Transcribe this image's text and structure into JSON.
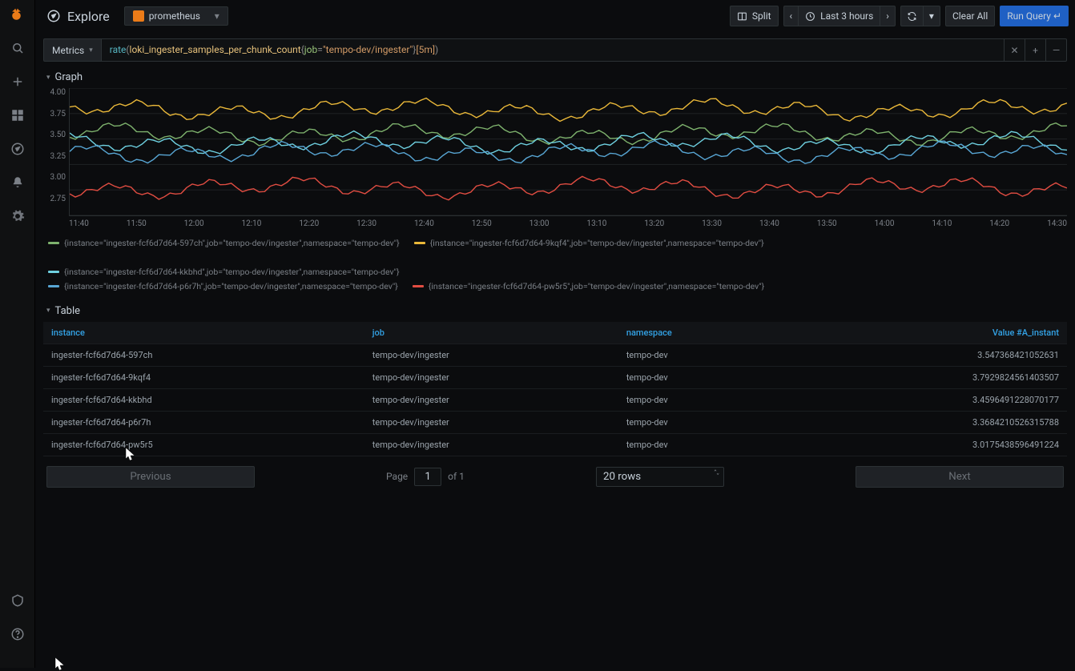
{
  "header": {
    "title": "Explore",
    "datasource": "prometheus",
    "split": "Split",
    "time_range": "Last 3 hours",
    "clear": "Clear All",
    "run": "Run Query ↵"
  },
  "query": {
    "metrics_btn": "Metrics",
    "expr_func": "rate",
    "expr_open": "(",
    "expr_metric": "loki_ingester_samples_per_chunk_count",
    "expr_brace_open": "{",
    "expr_label": "job",
    "expr_eq": "=",
    "expr_value": "\"tempo-dev/ingester\"",
    "expr_brace_close": "}",
    "expr_range": "[5m]",
    "expr_close": ")"
  },
  "sections": {
    "graph": "Graph",
    "table": "Table"
  },
  "chart_data": {
    "type": "line",
    "xlabel": "",
    "ylabel": "",
    "ylim": [
      2.75,
      4.0
    ],
    "yticks": [
      "4.00",
      "3.75",
      "3.50",
      "3.25",
      "3.00",
      "2.75"
    ],
    "xticks": [
      "11:40",
      "11:50",
      "12:00",
      "12:10",
      "12:20",
      "12:30",
      "12:40",
      "12:50",
      "13:00",
      "13:10",
      "13:20",
      "13:30",
      "13:40",
      "13:50",
      "14:00",
      "14:10",
      "14:20",
      "14:30"
    ],
    "series": [
      {
        "name": "{instance=\"ingester-fcf6d7d64-597ch\",job=\"tempo-dev/ingester\",namespace=\"tempo-dev\"}",
        "color": "#7eb26d",
        "mean": 3.55
      },
      {
        "name": "{instance=\"ingester-fcf6d7d64-9kqf4\",job=\"tempo-dev/ingester\",namespace=\"tempo-dev\"}",
        "color": "#eab839",
        "mean": 3.79
      },
      {
        "name": "{instance=\"ingester-fcf6d7d64-kkbhd\",job=\"tempo-dev/ingester\",namespace=\"tempo-dev\"}",
        "color": "#6ed0e0",
        "mean": 3.46
      },
      {
        "name": "{instance=\"ingester-fcf6d7d64-p6r7h\",job=\"tempo-dev/ingester\",namespace=\"tempo-dev\"}",
        "color": "#58a6d4",
        "mean": 3.37
      },
      {
        "name": "{instance=\"ingester-fcf6d7d64-pw5r5\",job=\"tempo-dev/ingester\",namespace=\"tempo-dev\"}",
        "color": "#e24d42",
        "mean": 3.02
      }
    ]
  },
  "table": {
    "columns": [
      "instance",
      "job",
      "namespace",
      "Value #A_instant"
    ],
    "rows": [
      {
        "instance": "ingester-fcf6d7d64-597ch",
        "job": "tempo-dev/ingester",
        "namespace": "tempo-dev",
        "value": "3.547368421052631"
      },
      {
        "instance": "ingester-fcf6d7d64-9kqf4",
        "job": "tempo-dev/ingester",
        "namespace": "tempo-dev",
        "value": "3.7929824561403507"
      },
      {
        "instance": "ingester-fcf6d7d64-kkbhd",
        "job": "tempo-dev/ingester",
        "namespace": "tempo-dev",
        "value": "3.4596491228070177"
      },
      {
        "instance": "ingester-fcf6d7d64-p6r7h",
        "job": "tempo-dev/ingester",
        "namespace": "tempo-dev",
        "value": "3.3684210526315788"
      },
      {
        "instance": "ingester-fcf6d7d64-pw5r5",
        "job": "tempo-dev/ingester",
        "namespace": "tempo-dev",
        "value": "3.0175438596491224"
      }
    ]
  },
  "pager": {
    "prev": "Previous",
    "next": "Next",
    "page_label": "Page",
    "page_value": "1",
    "of_label": "of 1",
    "rows_label": "20 rows"
  }
}
